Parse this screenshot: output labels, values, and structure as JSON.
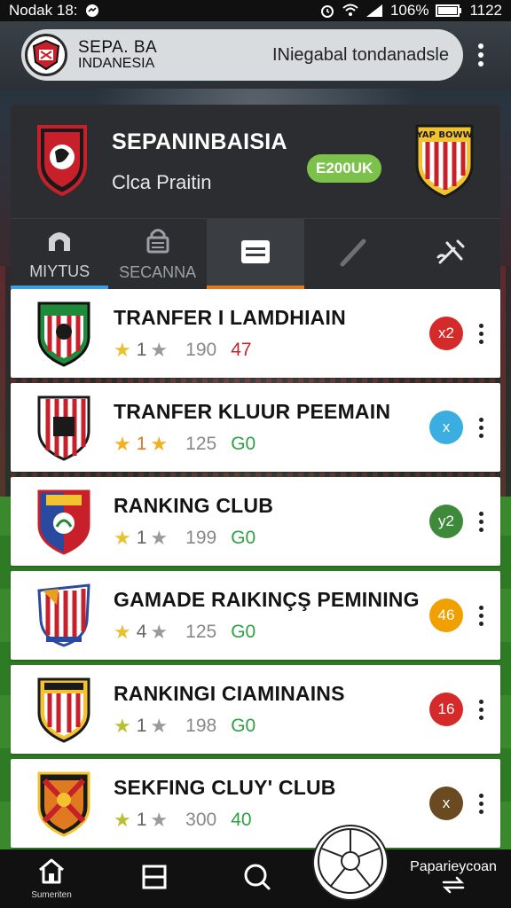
{
  "status_bar": {
    "left_text": "Nodak 18:",
    "battery": "106%",
    "time": "1122"
  },
  "top_bar": {
    "brand_line1": "SEPA. BA",
    "brand_line2": "INDANESIA",
    "tagline": "INiegabal tondanadsle"
  },
  "header": {
    "title": "SEPANINBAISIA",
    "subtitle": "Clca Praitin",
    "badge": "E200UK",
    "right_crest_text": "YAP BOWW"
  },
  "tabs": [
    {
      "label": "MIYTUS",
      "icon": "home-icon",
      "underline": "#3aa0e0"
    },
    {
      "label": "SECANNA",
      "icon": "lock-icon",
      "underline": ""
    },
    {
      "label": "",
      "icon": "list-icon",
      "underline": "#e07a20"
    },
    {
      "label": "",
      "icon": "pen-icon",
      "underline": ""
    },
    {
      "label": "",
      "icon": "tools-icon",
      "underline": ""
    }
  ],
  "items": [
    {
      "name": "TRANFER I LAMDHIAIN",
      "rating": "1",
      "count": "190",
      "score": "47",
      "score_color": "#c0262d",
      "badge": "x2",
      "badge_color": "#d42a2a",
      "star1": "#e8c030",
      "star2": "#9a9a9a"
    },
    {
      "name": "TRANFER KLUUR PEEMAIN",
      "rating": "1",
      "count": "125",
      "score": "G0",
      "score_color": "#2fa043",
      "badge": "x",
      "badge_color": "#3aaee0",
      "star1": "#f0b020",
      "star2": "#f0b020"
    },
    {
      "name": "RANKING CLUB",
      "rating": "1",
      "count": "199",
      "score": "G0",
      "score_color": "#2fa043",
      "badge": "y2",
      "badge_color": "#3f8a3a",
      "star1": "#e8c030",
      "star2": "#9a9a9a"
    },
    {
      "name": "GAMADE RAIKINÇŞ PEMINING",
      "rating": "4",
      "count": "125",
      "score": "G0",
      "score_color": "#2fa043",
      "badge": "46",
      "badge_color": "#f0a000",
      "star1": "#e8c030",
      "star2": "#9a9a9a"
    },
    {
      "name": "RANKINGI CIAMINAINS",
      "rating": "1",
      "count": "198",
      "score": "G0",
      "score_color": "#2fa043",
      "badge": "16",
      "badge_color": "#d42a2a",
      "star1": "#b8c030",
      "star2": "#9a9a9a"
    },
    {
      "name": "SEKFING CLUY' CLUB",
      "rating": "1",
      "count": "300",
      "score": "40",
      "score_color": "#2fa043",
      "badge": "x",
      "badge_color": "#6a4a20",
      "star1": "#b8c030",
      "star2": "#9a9a9a"
    }
  ],
  "bottom_nav": {
    "home_label": "Sumeriten",
    "right_label": "Paparieycoan"
  }
}
